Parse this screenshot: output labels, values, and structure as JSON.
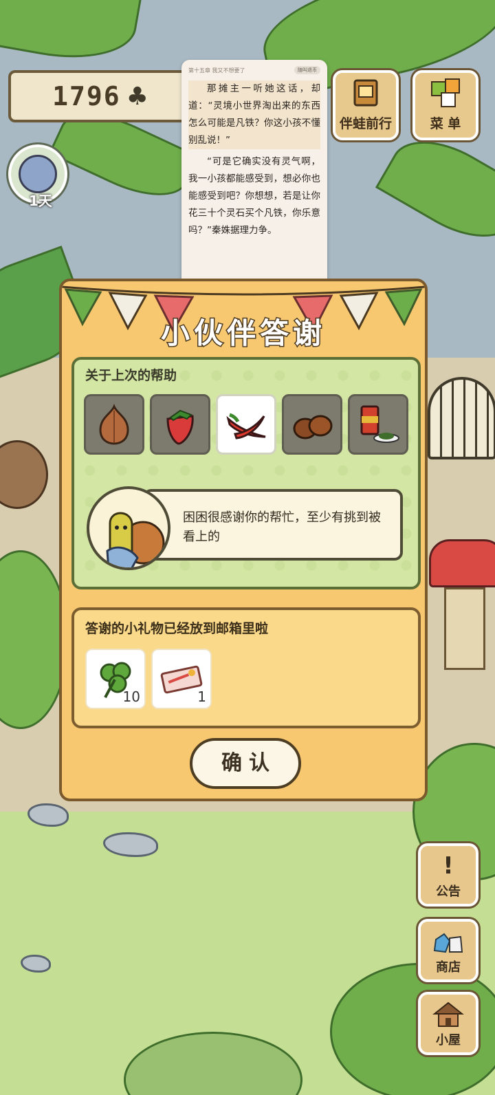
{
  "hud": {
    "clover_count": "1796",
    "clover_icon": "clover-icon",
    "day_label": "1天"
  },
  "top_buttons": {
    "travel_label": "伴蛙前行",
    "menu_label": "菜 单"
  },
  "reader": {
    "chapter": "第十五章 我又不想要了",
    "pill": "随叫退币",
    "para1": "那摊主一听她这话，却道：“灵境小世界淘出来的东西怎么可能是凡铁？你这小孩不懂别乱说！”",
    "para2": "“可是它确实没有灵气啊，我一小孩都能感受到，想必你也能感受到吧？你想想，若是让你花三十个灵石买个凡铁，你乐意吗？”秦姝据理力争。"
  },
  "dialog": {
    "title": "小伙伴答谢",
    "help_section_label": "关于上次的帮助",
    "help_items": [
      "onion-icon",
      "strawberry-icon",
      "chili-pepper-icon",
      "chestnut-icon",
      "canned-food-icon"
    ],
    "selected_index": 2,
    "speech": "困困很感谢你的帮忙，至少有挑到被看上的",
    "gift_section_label": "答谢的小礼物已经放到邮箱里啦",
    "gifts": [
      {
        "icon": "clover-icon",
        "count": "10"
      },
      {
        "icon": "ticket-icon",
        "count": "1"
      }
    ],
    "confirm_label": "确认"
  },
  "side_buttons": {
    "notice_label": "公告",
    "shop_label": "商店",
    "house_label": "小屋"
  },
  "colors": {
    "dialog_bg": "#f7c870",
    "help_panel_bg": "#d3e6a4",
    "gift_panel_bg": "#fbd98b",
    "button_bg": "#e8c78c"
  }
}
